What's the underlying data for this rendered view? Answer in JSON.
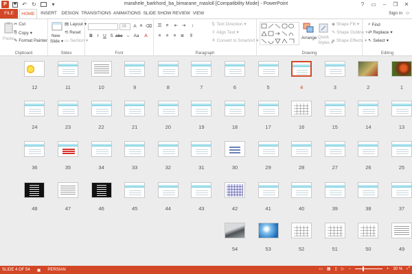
{
  "window": {
    "title": "marahele_barkhord_ba_bimarane_masloll [Compatibility Mode] - PowerPoint",
    "app_icon_letter": "P",
    "minimize": "–",
    "restore": "❐",
    "close": "✕"
  },
  "tabs": [
    {
      "label": "FILE"
    },
    {
      "label": "HOME"
    },
    {
      "label": "INSERT"
    },
    {
      "label": "DESIGN"
    },
    {
      "label": "TRANSITIONS"
    },
    {
      "label": "ANIMATIONS"
    },
    {
      "label": "SLIDE SHOW"
    },
    {
      "label": "REVIEW"
    },
    {
      "label": "VIEW"
    }
  ],
  "signin": "Sign in",
  "ribbon": {
    "clipboard": {
      "label": "Clipboard",
      "paste": "Paste",
      "cut": "Cut",
      "copy": "Copy",
      "format_painter": "Format Painter"
    },
    "slides": {
      "label": "Slides",
      "new_slide": "New",
      "new_slide2": "Slide",
      "layout": "Layout",
      "reset": "Reset",
      "section": "Section"
    },
    "font": {
      "label": "Font",
      "size": "26"
    },
    "paragraph": {
      "label": "Paragraph",
      "text_direction": "Text Direction",
      "align_text": "Align Text",
      "smartart": "Convert to SmartArt"
    },
    "drawing": {
      "label": "Drawing",
      "arrange": "Arrange",
      "quick_styles": "Quick",
      "quick_styles2": "Styles",
      "shape_fill": "Shape Fill",
      "shape_outline": "Shape Outline",
      "shape_effects": "Shape Effects"
    },
    "editing": {
      "label": "Editing",
      "find": "Find",
      "replace": "Replace",
      "select": "Select"
    }
  },
  "slides": [
    {
      "n": "1",
      "kind": "photo-butterfly"
    },
    {
      "n": "2",
      "kind": "photo-flower"
    },
    {
      "n": "3",
      "kind": "text"
    },
    {
      "n": "4",
      "kind": "text",
      "selected": true
    },
    {
      "n": "5",
      "kind": "text"
    },
    {
      "n": "6",
      "kind": "text"
    },
    {
      "n": "7",
      "kind": "text"
    },
    {
      "n": "8",
      "kind": "text"
    },
    {
      "n": "9",
      "kind": "text"
    },
    {
      "n": "10",
      "kind": "doc"
    },
    {
      "n": "11",
      "kind": "text"
    },
    {
      "n": "12",
      "kind": "sun"
    },
    {
      "n": "13",
      "kind": "text"
    },
    {
      "n": "14",
      "kind": "text"
    },
    {
      "n": "15",
      "kind": "text"
    },
    {
      "n": "16",
      "kind": "table"
    },
    {
      "n": "17",
      "kind": "text"
    },
    {
      "n": "18",
      "kind": "text"
    },
    {
      "n": "19",
      "kind": "text"
    },
    {
      "n": "20",
      "kind": "text"
    },
    {
      "n": "21",
      "kind": "text"
    },
    {
      "n": "22",
      "kind": "text"
    },
    {
      "n": "23",
      "kind": "text"
    },
    {
      "n": "24",
      "kind": "text"
    },
    {
      "n": "25",
      "kind": "text"
    },
    {
      "n": "26",
      "kind": "text"
    },
    {
      "n": "27",
      "kind": "text"
    },
    {
      "n": "28",
      "kind": "text"
    },
    {
      "n": "29",
      "kind": "text"
    },
    {
      "n": "30",
      "kind": "diagram"
    },
    {
      "n": "31",
      "kind": "text"
    },
    {
      "n": "32",
      "kind": "text"
    },
    {
      "n": "33",
      "kind": "text"
    },
    {
      "n": "34",
      "kind": "text"
    },
    {
      "n": "35",
      "kind": "red"
    },
    {
      "n": "36",
      "kind": "text"
    },
    {
      "n": "37",
      "kind": "text"
    },
    {
      "n": "38",
      "kind": "text"
    },
    {
      "n": "39",
      "kind": "text"
    },
    {
      "n": "40",
      "kind": "text"
    },
    {
      "n": "41",
      "kind": "text"
    },
    {
      "n": "42",
      "kind": "grid"
    },
    {
      "n": "43",
      "kind": "text"
    },
    {
      "n": "44",
      "kind": "text"
    },
    {
      "n": "45",
      "kind": "text"
    },
    {
      "n": "46",
      "kind": "dark"
    },
    {
      "n": "47",
      "kind": "doc"
    },
    {
      "n": "48",
      "kind": "dark"
    },
    {
      "n": "49",
      "kind": "doc"
    },
    {
      "n": "50",
      "kind": "table"
    },
    {
      "n": "51",
      "kind": "table"
    },
    {
      "n": "52",
      "kind": "table"
    },
    {
      "n": "53",
      "kind": "photo-sky"
    },
    {
      "n": "54",
      "kind": "photo-laptop"
    }
  ],
  "status": {
    "slide_info": "SLIDE 4 OF 54",
    "language": "PERSIAN",
    "zoom": "30 %",
    "zoom_level": 0.3
  },
  "colors": {
    "accent": "#d24726",
    "selection": "#d24726"
  }
}
